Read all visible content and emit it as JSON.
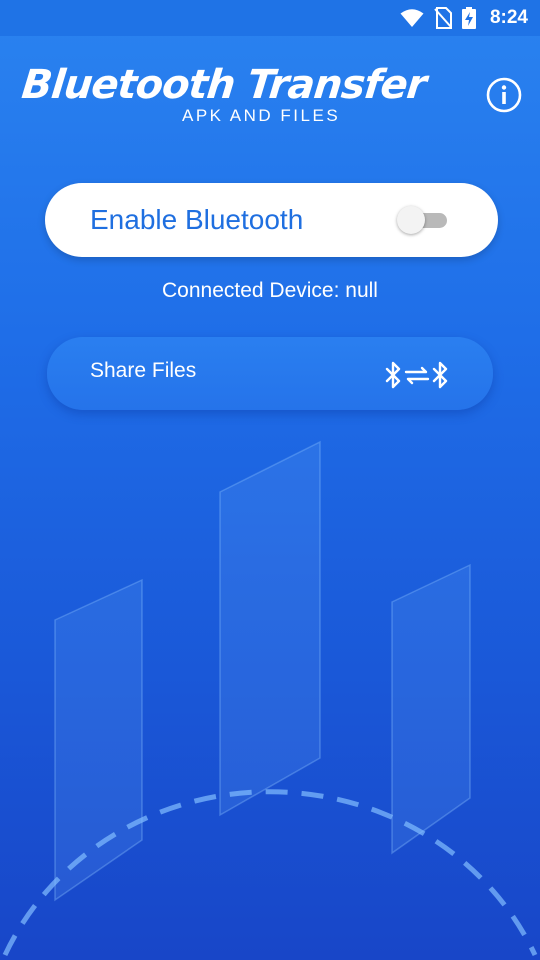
{
  "status_bar": {
    "time": "8:24",
    "icons": [
      "wifi-icon",
      "no-sim-icon",
      "battery-charging-icon"
    ]
  },
  "header": {
    "title": "Bluetooth Transfer",
    "subtitle": "APK AND FILES",
    "info_icon": "info-icon"
  },
  "bluetooth": {
    "enable_label": "Enable Bluetooth",
    "enabled": false,
    "connected_text": "Connected Device: null"
  },
  "share": {
    "label": "Share Files",
    "icon": "bluetooth-transfer-icon"
  },
  "colors": {
    "background_top": "#2a83f0",
    "background_bottom": "#1846c8",
    "accent_text": "#1f6fe0",
    "card_background": "#ffffff",
    "toggle_off_track": "#b9b9b9"
  }
}
